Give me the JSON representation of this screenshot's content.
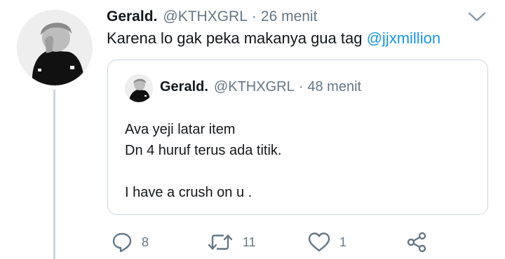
{
  "tweet": {
    "author_name": "Gerald.",
    "author_handle": "@KTHXGRL",
    "separator": "·",
    "time": "26 menit",
    "text": "Karena lo gak peka makanya gua tag ",
    "mention": "@jjxmillion"
  },
  "quoted": {
    "author_name": "Gerald.",
    "author_handle": "@KTHXGRL",
    "separator": "·",
    "time": "48 menit",
    "lines": [
      "Ava yeji latar item",
      "Dn 4 huruf terus ada titik.",
      "I have a crush on u ."
    ]
  },
  "actions": {
    "reply_count": "8",
    "retweet_count": "11",
    "like_count": "1"
  },
  "colors": {
    "primary_text": "#14171a",
    "secondary_text": "#657786",
    "link": "#1b95e0",
    "border": "#ccd6dd",
    "thread_line": "#cfd6dc"
  }
}
